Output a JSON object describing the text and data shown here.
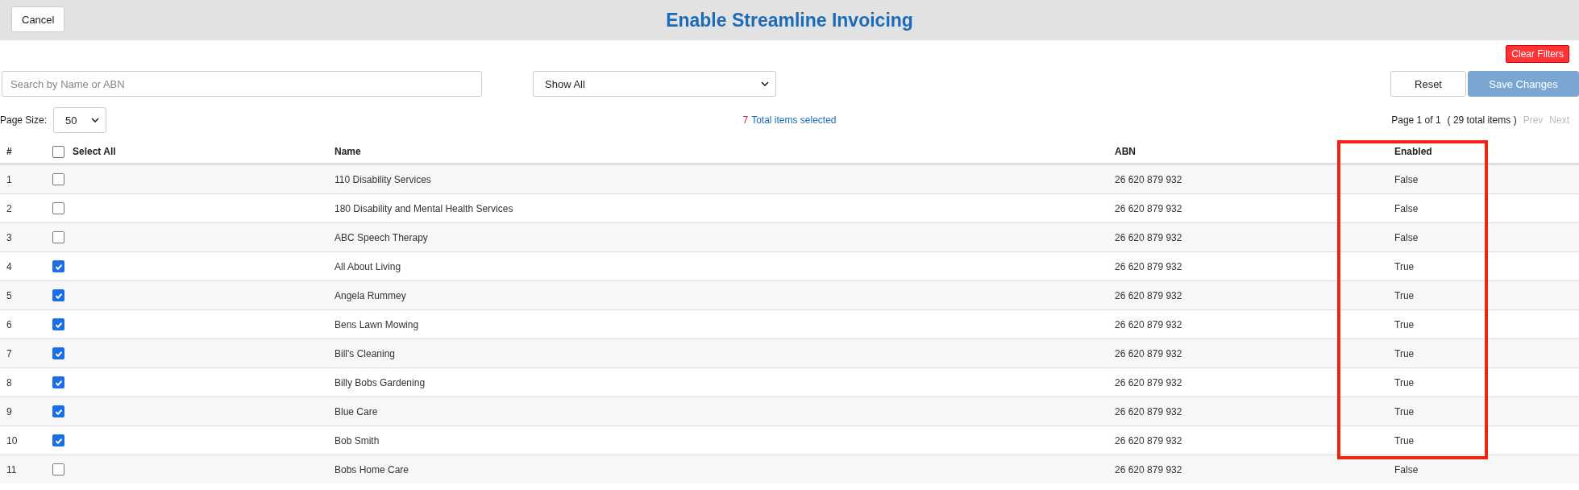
{
  "header": {
    "cancel_button": "Cancel",
    "title": "Enable Streamline Invoicing"
  },
  "toolbar": {
    "clear_filters": "Clear Filters",
    "search": {
      "placeholder": "Search by Name or ABN"
    },
    "filter_select": "Show All",
    "reset_button": "Reset",
    "save_button": "Save Changes",
    "save_disabled": true
  },
  "pager": {
    "page_size_label": "Page Size:",
    "page_size": "50",
    "selected_count": "7",
    "selected_text": "Total items selected",
    "page_info": "Page 1 of 1",
    "total_items": "( 29 total items )",
    "prev": "Prev",
    "next": "Next",
    "prev_disabled": true,
    "next_disabled": true
  },
  "table": {
    "columns": [
      "#",
      "Select All",
      "Name",
      "ABN",
      "Enabled"
    ],
    "select_all_checked": false,
    "rows": [
      {
        "index": "1",
        "checked": false,
        "name": "110 Disability Services",
        "abn": "26 620 879 932",
        "enabled": "False"
      },
      {
        "index": "2",
        "checked": false,
        "name": "180 Disability and Mental Health Services",
        "abn": "26 620 879 932",
        "enabled": "False"
      },
      {
        "index": "3",
        "checked": false,
        "name": "ABC Speech Therapy",
        "abn": "26 620 879 932",
        "enabled": "False"
      },
      {
        "index": "4",
        "checked": true,
        "name": "All About Living",
        "abn": "26 620 879 932",
        "enabled": "True"
      },
      {
        "index": "5",
        "checked": true,
        "name": "Angela Rummey",
        "abn": "26 620 879 932",
        "enabled": "True"
      },
      {
        "index": "6",
        "checked": true,
        "name": "Bens Lawn Mowing",
        "abn": "26 620 879 932",
        "enabled": "True"
      },
      {
        "index": "7",
        "checked": true,
        "name": "Bill's Cleaning",
        "abn": "26 620 879 932",
        "enabled": "True"
      },
      {
        "index": "8",
        "checked": true,
        "name": "Billy Bobs Gardening",
        "abn": "26 620 879 932",
        "enabled": "True"
      },
      {
        "index": "9",
        "checked": true,
        "name": "Blue Care",
        "abn": "26 620 879 932",
        "enabled": "True"
      },
      {
        "index": "10",
        "checked": true,
        "name": "Bob Smith",
        "abn": "26 620 879 932",
        "enabled": "True"
      },
      {
        "index": "11",
        "checked": false,
        "name": "Bobs Home Care",
        "abn": "26 620 879 932",
        "enabled": "False"
      }
    ]
  }
}
